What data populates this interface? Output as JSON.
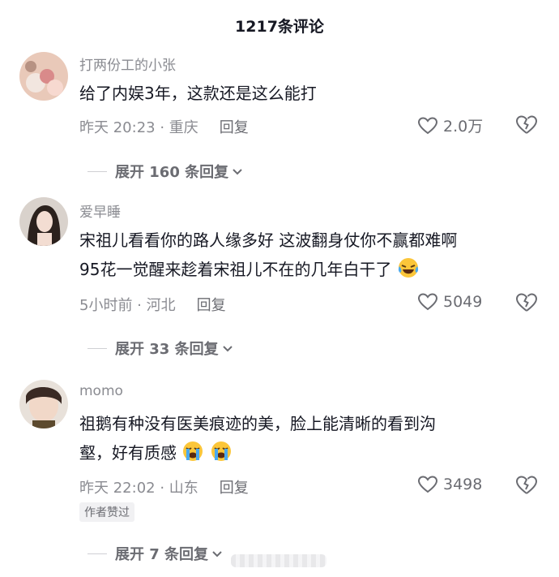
{
  "header": {
    "title": "1217条评论"
  },
  "comments": [
    {
      "username": "打两份工的小张",
      "text_line1": "给了内娱3年，这款还是这么能打",
      "text_line2": "",
      "meta": "昨天 20:23 · 重庆",
      "reply_label": "回复",
      "likes": "2.0万",
      "expand_label": "展开 160 条回复",
      "avatar_icon": "avatar-photo-flowers"
    },
    {
      "username": "爱早睡",
      "text_line1": "宋祖儿看看你的路人缘多好 这波翻身仗你不赢都难啊",
      "text_line2": "95花一觉醒来趁着宋祖儿不在的几年白干了",
      "meta": "5小时前 · 河北",
      "reply_label": "回复",
      "likes": "5049",
      "expand_label": "展开 33 条回复",
      "emoji": "laugh-cry-emoji",
      "avatar_icon": "avatar-photo-woman"
    },
    {
      "username": "momo",
      "text_line1": "祖鹅有种没有医美痕迹的美，脸上能清晰的看到沟",
      "text_line2": "壑，好有质感",
      "meta": "昨天 22:02 · 山东",
      "reply_label": "回复",
      "likes": "3498",
      "badge": "作者赞过",
      "expand_label": "展开 7 条回复",
      "emoji": "loudly-crying-emoji",
      "avatar_icon": "avatar-photo-girl"
    }
  ],
  "colors": {
    "text": "#161823",
    "secondary": "#8a8b91",
    "action": "#6b6c72"
  }
}
